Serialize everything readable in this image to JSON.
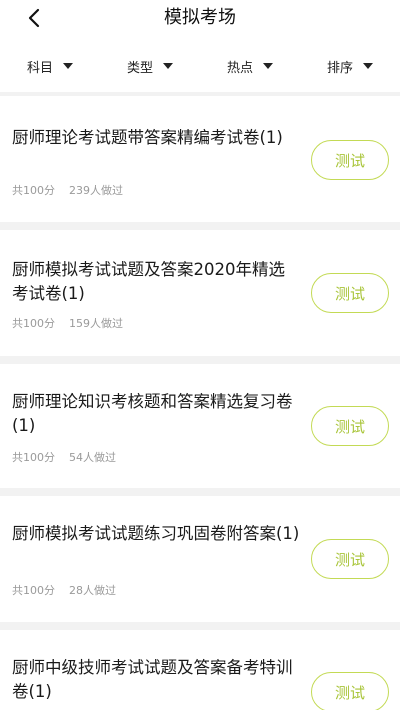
{
  "header": {
    "title": "模拟考场"
  },
  "filters": [
    {
      "label": "科目"
    },
    {
      "label": "类型"
    },
    {
      "label": "热点"
    },
    {
      "label": "排序"
    }
  ],
  "exams": [
    {
      "title": "厨师理论考试题带答案精编考试卷(1)",
      "total": "共100分",
      "count": "239人做过",
      "button": "测试"
    },
    {
      "title": "厨师模拟考试试题及答案2020年精选考试卷(1)",
      "total": "共100分",
      "count": "159人做过",
      "button": "测试"
    },
    {
      "title": "厨师理论知识考核题和答案精选复习卷(1)",
      "total": "共100分",
      "count": "54人做过",
      "button": "测试"
    },
    {
      "title": "厨师模拟考试试题练习巩固卷附答案(1)",
      "total": "共100分",
      "count": "28人做过",
      "button": "测试"
    },
    {
      "title": "厨师中级技师考试试题及答案备考特训卷(1)",
      "button": "测试"
    }
  ]
}
